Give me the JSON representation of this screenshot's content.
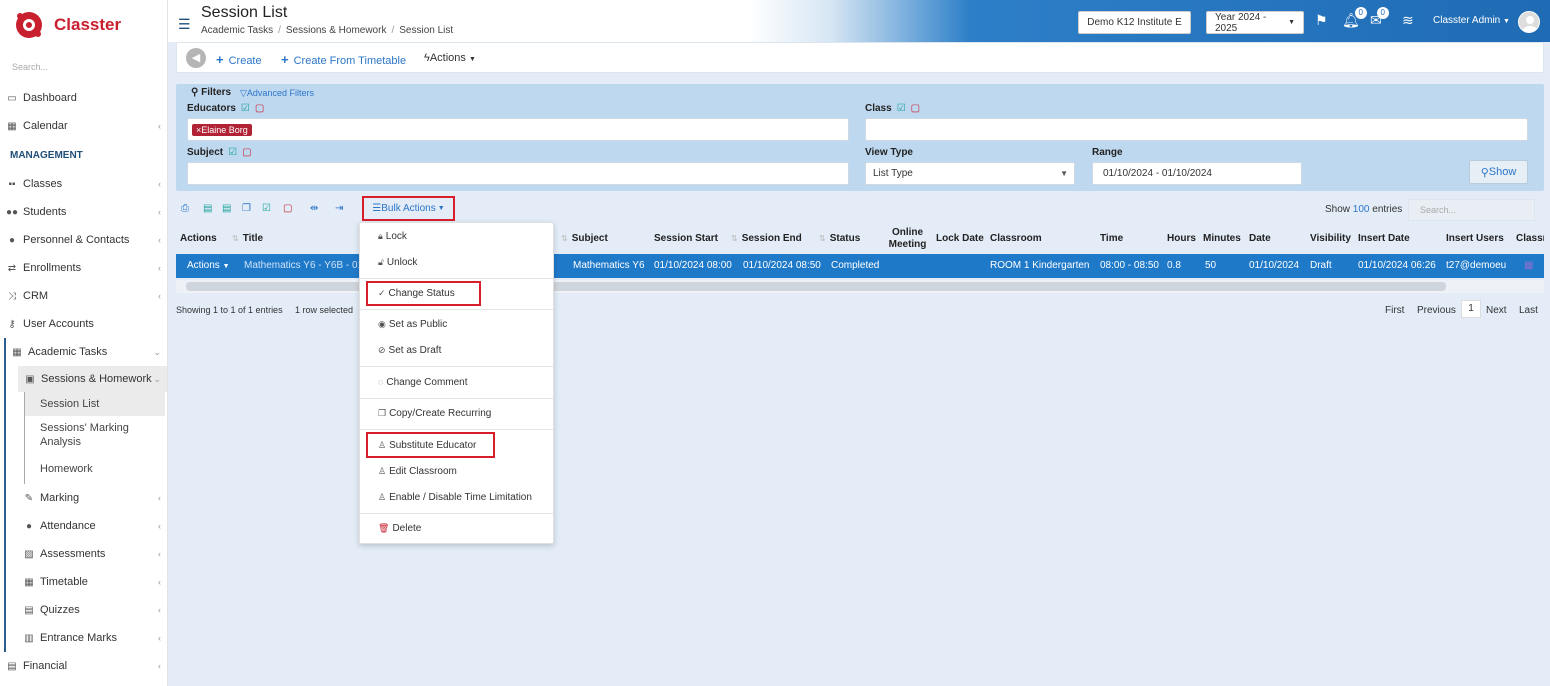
{
  "app": {
    "name": "Classter",
    "search_placeholder": "Search..."
  },
  "sidebar": {
    "section_management": "MANAGEMENT",
    "items": {
      "dashboard": "Dashboard",
      "calendar": "Calendar",
      "classes": "Classes",
      "students": "Students",
      "personnel": "Personnel & Contacts",
      "enrollments": "Enrollments",
      "crm": "CRM",
      "user_accounts": "User Accounts",
      "academic_tasks": "Academic Tasks",
      "sessions_homework": "Sessions & Homework",
      "session_list": "Session List",
      "marking_analysis": "Sessions' Marking Analysis",
      "homework": "Homework",
      "marking": "Marking",
      "attendance": "Attendance",
      "assessments": "Assessments",
      "timetable": "Timetable",
      "quizzes": "Quizzes",
      "entrance_marks": "Entrance Marks",
      "financial": "Financial"
    }
  },
  "header": {
    "title": "Session List",
    "breadcrumb": [
      "Academic Tasks",
      "Sessions & Homework",
      "Session List"
    ],
    "institute": "Demo K12 Institute E",
    "year": "Year 2024 - 2025",
    "notif_count": "0",
    "mail_count": "0",
    "user": "Classter Admin"
  },
  "toolbar": {
    "create": "Create",
    "create_timetable": "Create From Timetable",
    "actions": "Actions"
  },
  "filters": {
    "title": "Filters",
    "advanced": "Advanced Filters",
    "educators_label": "Educators",
    "educator_tag": "Elaine Borg",
    "class_label": "Class",
    "subject_label": "Subject",
    "view_type_label": "View Type",
    "view_type_value": "List Type",
    "range_label": "Range",
    "range_value": "01/10/2024 - 01/10/2024",
    "show_button": "Show"
  },
  "table_tools": {
    "bulk_actions": "Bulk Actions",
    "show": "Show",
    "entries_count": "100",
    "entries": "entries",
    "search_placeholder": "Search..."
  },
  "table": {
    "headers": {
      "actions": "Actions",
      "title": "Title",
      "subject": "Subject",
      "session_start": "Session Start",
      "session_end": "Session End",
      "status": "Status",
      "online_meeting": "Online Meeting",
      "lock_date": "Lock Date",
      "classroom": "Classroom",
      "time": "Time",
      "hours": "Hours",
      "minutes": "Minutes",
      "date": "Date",
      "visibility": "Visibility",
      "insert_date": "Insert Date",
      "insert_users": "Insert Users",
      "classr": "Classr"
    },
    "row": {
      "actions": "Actions",
      "title": "Mathematics Y6 - Y6B - 01",
      "subject": "Mathematics Y6",
      "session_start": "01/10/2024 08:00",
      "session_end": "01/10/2024 08:50",
      "status": "Completed",
      "classroom": "ROOM 1 Kindergarten",
      "time": "08:00 - 08:50",
      "hours": "0.8",
      "minutes": "50",
      "date": "01/10/2024",
      "visibility": "Draft",
      "insert_date": "01/10/2024 06:26",
      "insert_users": "t27@demoeu"
    },
    "footer": {
      "showing": "Showing 1 to 1 of 1 entries",
      "selected": "1 row selected"
    },
    "pager": {
      "first": "First",
      "previous": "Previous",
      "current": "1",
      "next": "Next",
      "last": "Last"
    }
  },
  "bulk_menu": {
    "lock": "Lock",
    "unlock": "Unlock",
    "change_status": "Change Status",
    "set_public": "Set as Public",
    "set_draft": "Set as Draft",
    "change_comment": "Change Comment",
    "copy_recurring": "Copy/Create Recurring",
    "substitute_educator": "Substitute Educator",
    "edit_classroom": "Edit Classroom",
    "time_limitation": "Enable / Disable Time Limitation",
    "delete": "Delete"
  },
  "colors": {
    "brand_red": "#c8202f",
    "header_blue": "#1f6bb4",
    "link_blue": "#2c76c9",
    "selected_row": "#1f79c9",
    "filter_bg": "#bed8ef",
    "highlight_red": "#d91e2b"
  }
}
